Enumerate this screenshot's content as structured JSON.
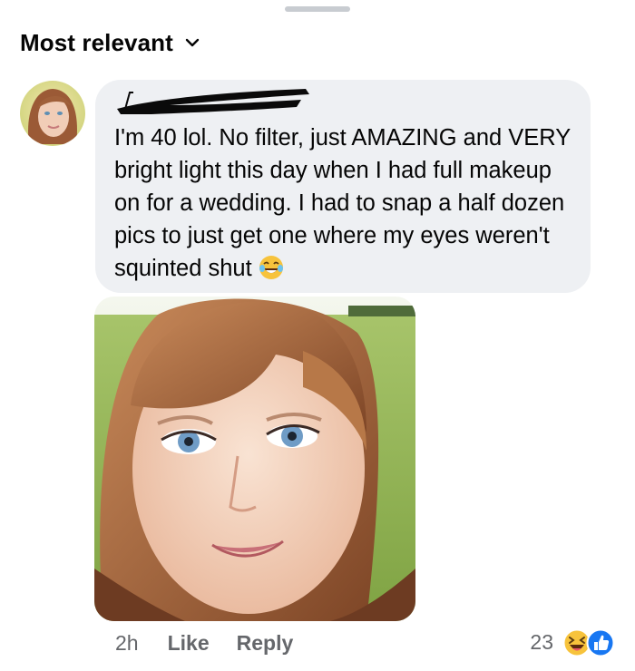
{
  "sheet": {
    "sort_label": "Most relevant"
  },
  "comment": {
    "text": "I'm 40 lol. No filter, just AMAZING and VERY bright light this day when I had full makeup on for a wedding. I had to snap a half dozen pics to just get one where my eyes weren't squinted shut",
    "inline_emoji": "tears-of-joy-icon",
    "time": "2h",
    "like_label": "Like",
    "reply_label": "Reply",
    "reaction_count": "23",
    "reactions": [
      "haha-reaction-icon",
      "like-reaction-icon"
    ]
  },
  "colors": {
    "bubble": "#eef0f3",
    "secondary_text": "#65676b",
    "like_blue": "#1877f2",
    "haha_yellow": "#f7c33c"
  }
}
